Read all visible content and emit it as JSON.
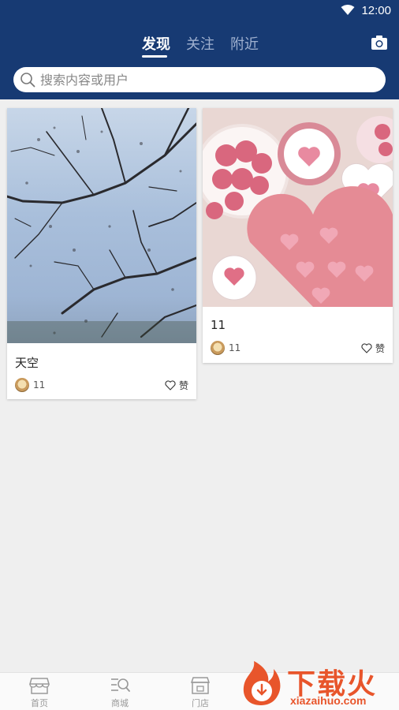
{
  "status": {
    "time": "12:00"
  },
  "tabs": [
    {
      "label": "发现",
      "active": true
    },
    {
      "label": "关注",
      "active": false
    },
    {
      "label": "附近",
      "active": false
    }
  ],
  "search": {
    "placeholder": "搜索内容或用户"
  },
  "feed": [
    {
      "title": "天空",
      "user": "11",
      "like_label": "赞"
    },
    {
      "title": "11",
      "user": "11",
      "like_label": "赞"
    }
  ],
  "tabbar": [
    {
      "label": "首页",
      "icon": "store-icon"
    },
    {
      "label": "商城",
      "icon": "list-search-icon"
    },
    {
      "label": "门店",
      "icon": "shop-icon"
    }
  ],
  "watermark": {
    "title": "下载火",
    "subtitle": "xiazaihuo.com"
  },
  "colors": {
    "header": "#173a73",
    "background": "#efefef",
    "watermark": "#e8552b"
  }
}
